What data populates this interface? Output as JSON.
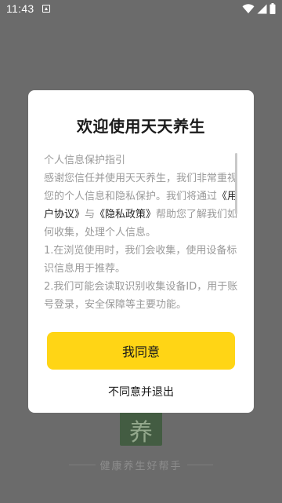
{
  "status_bar": {
    "time": "11:43",
    "icons": [
      "app-notification-icon",
      "wifi-icon",
      "signal-icon",
      "battery-icon"
    ]
  },
  "background": {
    "logo_char": "养",
    "slogan": "健康养生好帮手"
  },
  "dialog": {
    "title": "欢迎使用天天养生",
    "policy_heading": "个人信息保护指引",
    "policy_intro_before": "感谢您信任并使用天天养生，我们非常重视您的个人信息和隐私保护。我们将通过",
    "user_agreement_link": "《用户协议》",
    "policy_and": "与",
    "privacy_policy_link": "《隐私政策》",
    "policy_intro_after": "帮助您了解我们如何收集，处理个人信息。",
    "policy_point_1": "1.在浏览使用时，我们会收集，使用设备标识信息用于推荐。",
    "policy_point_2": "2.我们可能会读取识别收集设备ID，用于账号登录，安全保障等主要功能。",
    "agree_label": "我同意",
    "decline_label": "不同意并退出"
  },
  "colors": {
    "accent": "#ffd515",
    "overlay": "#6b6b6b"
  }
}
